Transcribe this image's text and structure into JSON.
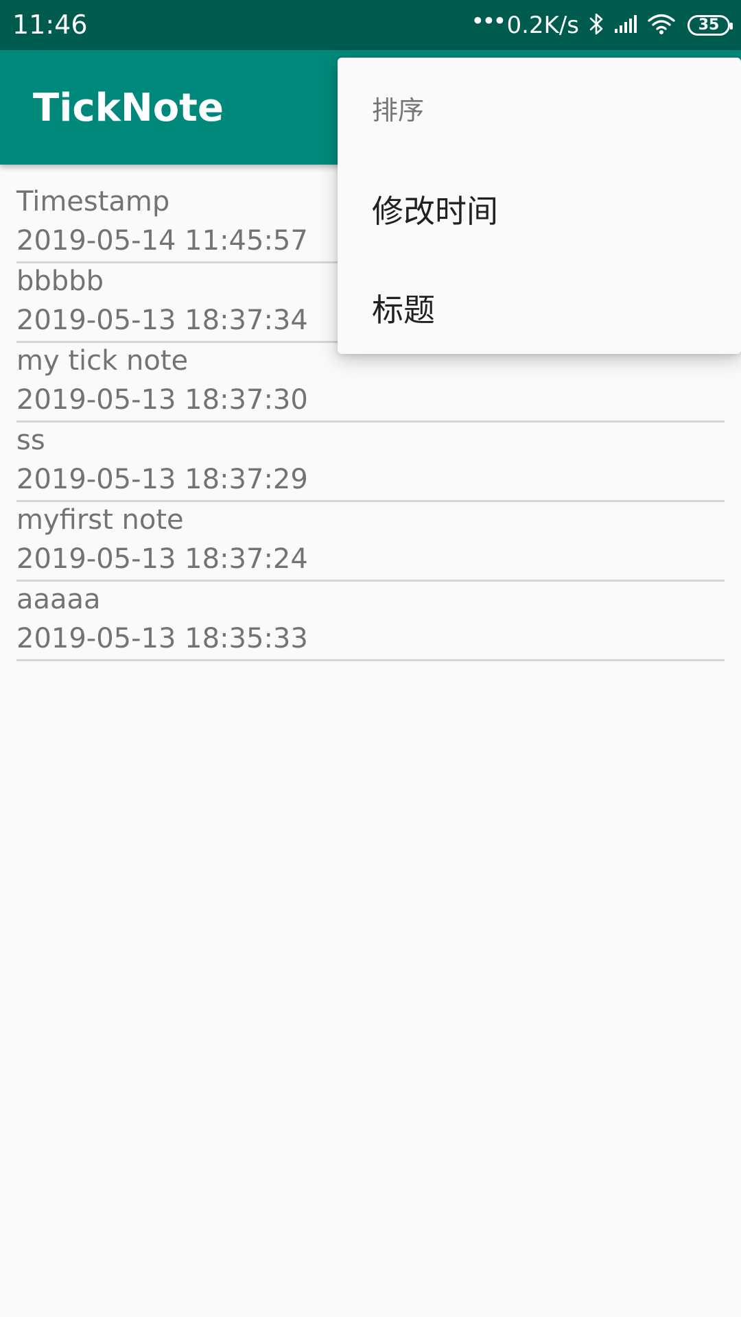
{
  "status_bar": {
    "time": "11:46",
    "network_speed": "0.2K/s",
    "battery_level": "35",
    "background": "#005b4f"
  },
  "app_bar": {
    "title": "TickNote",
    "background": "#00897b"
  },
  "notes": [
    {
      "title": "Timestamp",
      "timestamp": "2019-05-14 11:45:57"
    },
    {
      "title": "bbbbb",
      "timestamp": "2019-05-13 18:37:34"
    },
    {
      "title": "my tick note",
      "timestamp": "2019-05-13 18:37:30"
    },
    {
      "title": "ss",
      "timestamp": "2019-05-13 18:37:29"
    },
    {
      "title": "myfirst note",
      "timestamp": "2019-05-13 18:37:24"
    },
    {
      "title": "aaaaa",
      "timestamp": "2019-05-13 18:35:33"
    }
  ],
  "sort_menu": {
    "header": "排序",
    "items": [
      {
        "label": "修改时间"
      },
      {
        "label": "标题"
      }
    ]
  }
}
